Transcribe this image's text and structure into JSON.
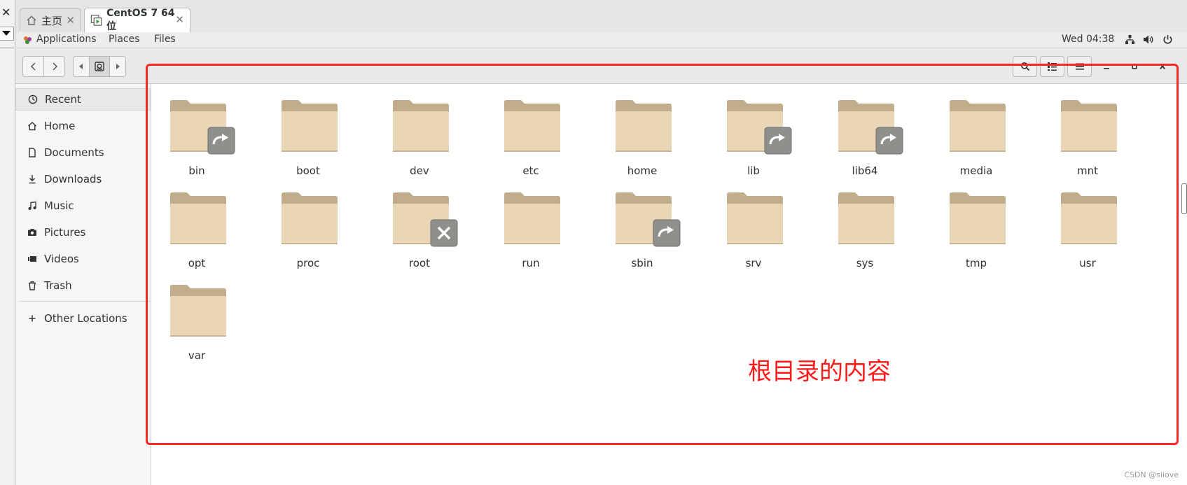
{
  "host": {
    "close_glyph": "✕"
  },
  "vm_tabs": [
    {
      "label": "主页",
      "icon": "home-icon",
      "active": false
    },
    {
      "label": "CentOS 7 64 位",
      "icon": "vm-icon",
      "active": true
    }
  ],
  "panel": {
    "applications": "Applications",
    "places": "Places",
    "files": "Files",
    "clock": "Wed 04:38"
  },
  "headerbar": {
    "back_icon": "chevron-left-icon",
    "forward_icon": "chevron-right-icon",
    "path_icon": "drive-icon",
    "search_icon": "search-icon",
    "view_icon": "list-view-icon",
    "menu_icon": "hamburger-menu-icon"
  },
  "sidebar": {
    "items": [
      {
        "label": "Recent",
        "icon": "clock-icon",
        "active": true
      },
      {
        "label": "Home",
        "icon": "home-icon",
        "active": false
      },
      {
        "label": "Documents",
        "icon": "document-icon",
        "active": false
      },
      {
        "label": "Downloads",
        "icon": "download-icon",
        "active": false
      },
      {
        "label": "Music",
        "icon": "music-icon",
        "active": false
      },
      {
        "label": "Pictures",
        "icon": "camera-icon",
        "active": false
      },
      {
        "label": "Videos",
        "icon": "video-icon",
        "active": false
      },
      {
        "label": "Trash",
        "icon": "trash-icon",
        "active": false
      }
    ],
    "other_locations": "Other Locations"
  },
  "files": [
    {
      "name": "bin",
      "badge": "symlink"
    },
    {
      "name": "boot",
      "badge": ""
    },
    {
      "name": "dev",
      "badge": ""
    },
    {
      "name": "etc",
      "badge": ""
    },
    {
      "name": "home",
      "badge": ""
    },
    {
      "name": "lib",
      "badge": "symlink"
    },
    {
      "name": "lib64",
      "badge": "symlink"
    },
    {
      "name": "media",
      "badge": ""
    },
    {
      "name": "mnt",
      "badge": ""
    },
    {
      "name": "opt",
      "badge": ""
    },
    {
      "name": "proc",
      "badge": ""
    },
    {
      "name": "root",
      "badge": "no-access"
    },
    {
      "name": "run",
      "badge": ""
    },
    {
      "name": "sbin",
      "badge": "symlink"
    },
    {
      "name": "srv",
      "badge": ""
    },
    {
      "name": "sys",
      "badge": ""
    },
    {
      "name": "tmp",
      "badge": ""
    },
    {
      "name": "usr",
      "badge": ""
    },
    {
      "name": "var",
      "badge": ""
    }
  ],
  "annotation": "根目录的内容",
  "watermark": "CSDN @siiove",
  "colors": {
    "annotation_red": "#ff2626",
    "folder_body": "#e9d6b7",
    "folder_back": "#c2ad8a",
    "badge_gray": "#8f8f8b"
  }
}
